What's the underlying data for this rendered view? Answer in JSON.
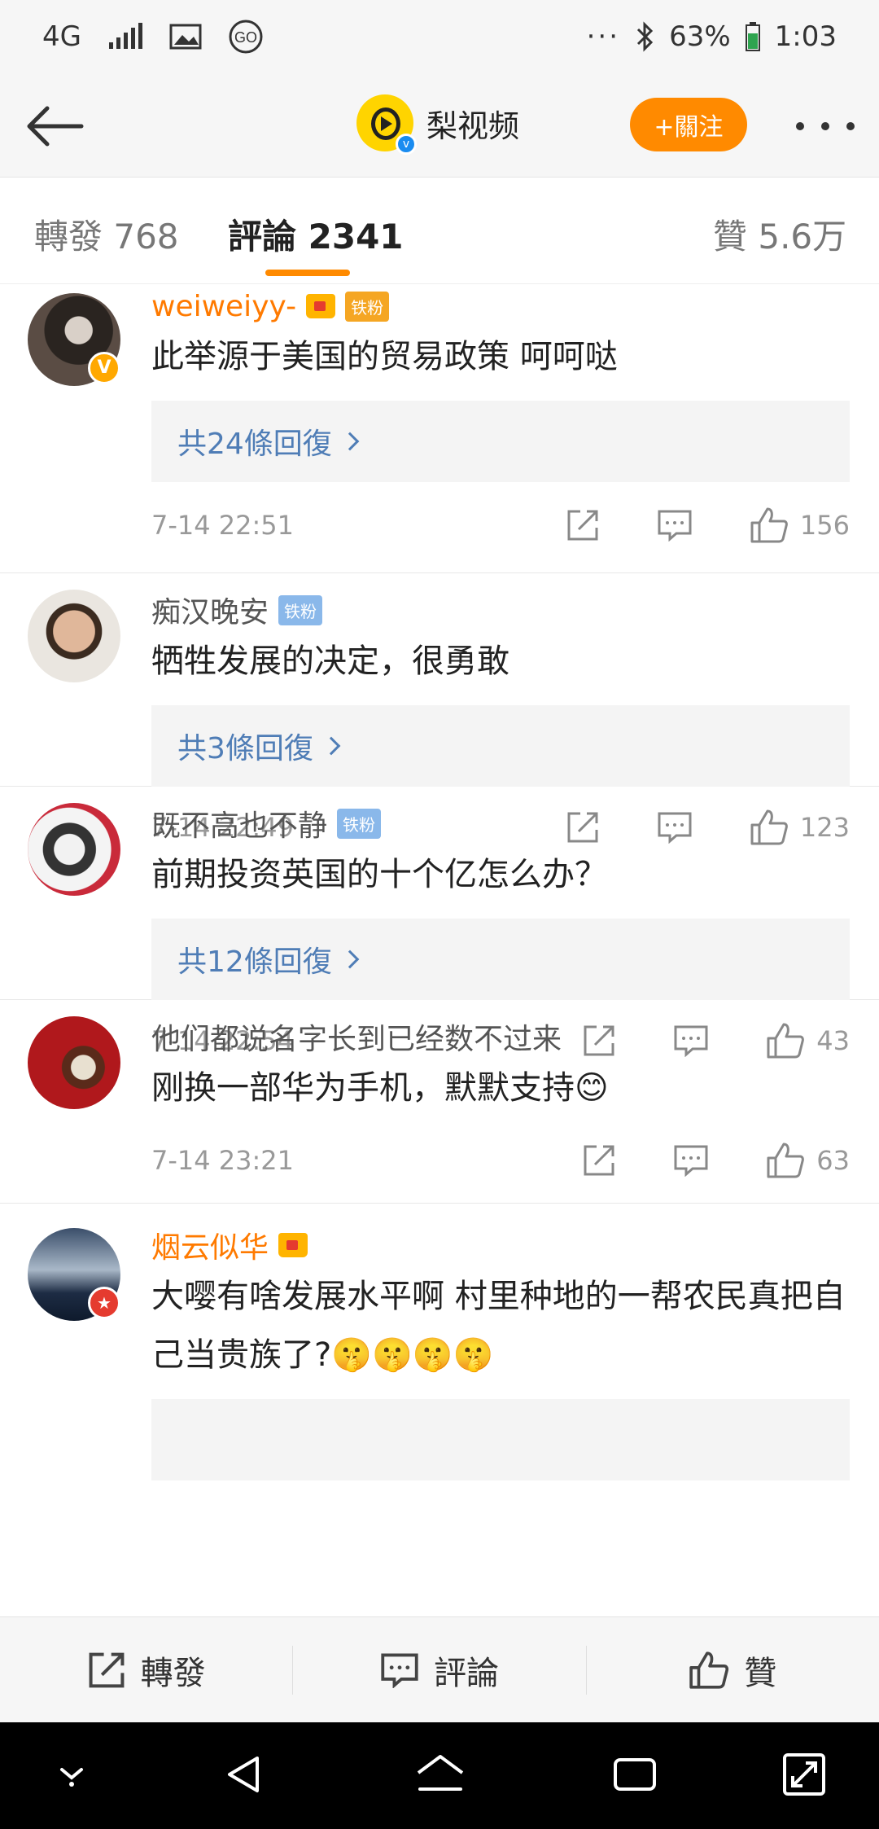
{
  "status_bar": {
    "network": "4G",
    "battery": "63%",
    "time": "1:03"
  },
  "nav": {
    "account_name": "梨视频",
    "follow_label": "+關注"
  },
  "tabs": [
    {
      "label": "轉發 768"
    },
    {
      "label": "評論 2341"
    },
    {
      "label": "贊 5.6万"
    }
  ],
  "comments": [
    {
      "user": "weiweiyy-",
      "fan_badge": "铁粉",
      "text": "此举源于美国的贸易政策 呵呵哒",
      "replies": "共24條回復",
      "time": "7-14 22:51",
      "likes": "156"
    },
    {
      "user": "痴汉晚安",
      "fan_badge": "铁粉",
      "text": "牺牲发展的决定，很勇敢",
      "replies": "共3條回復",
      "time": "7-14 22:49",
      "likes": "123"
    },
    {
      "user": "既不高也不静",
      "fan_badge": "铁粉",
      "text": "前期投资英国的十个亿怎么办？",
      "replies": "共12條回復",
      "time": "7-14 22:54",
      "likes": "43"
    },
    {
      "user": "他们都说名字长到已经数不过来",
      "text": "刚换一部华为手机，默默支持😊",
      "time": "7-14 23:21",
      "likes": "63"
    },
    {
      "user": "烟云似华",
      "text": "大嘤有啥发展水平啊 村里种地的一帮农民真把自己当贵族了?🤫🤫🤫🤫"
    }
  ],
  "bottom_bar": {
    "repost": "轉發",
    "comment": "評論",
    "like": "贊"
  },
  "colors": {
    "accent": "#ff8a00",
    "link": "#4f7db6",
    "vip_name": "#ff7a00"
  }
}
